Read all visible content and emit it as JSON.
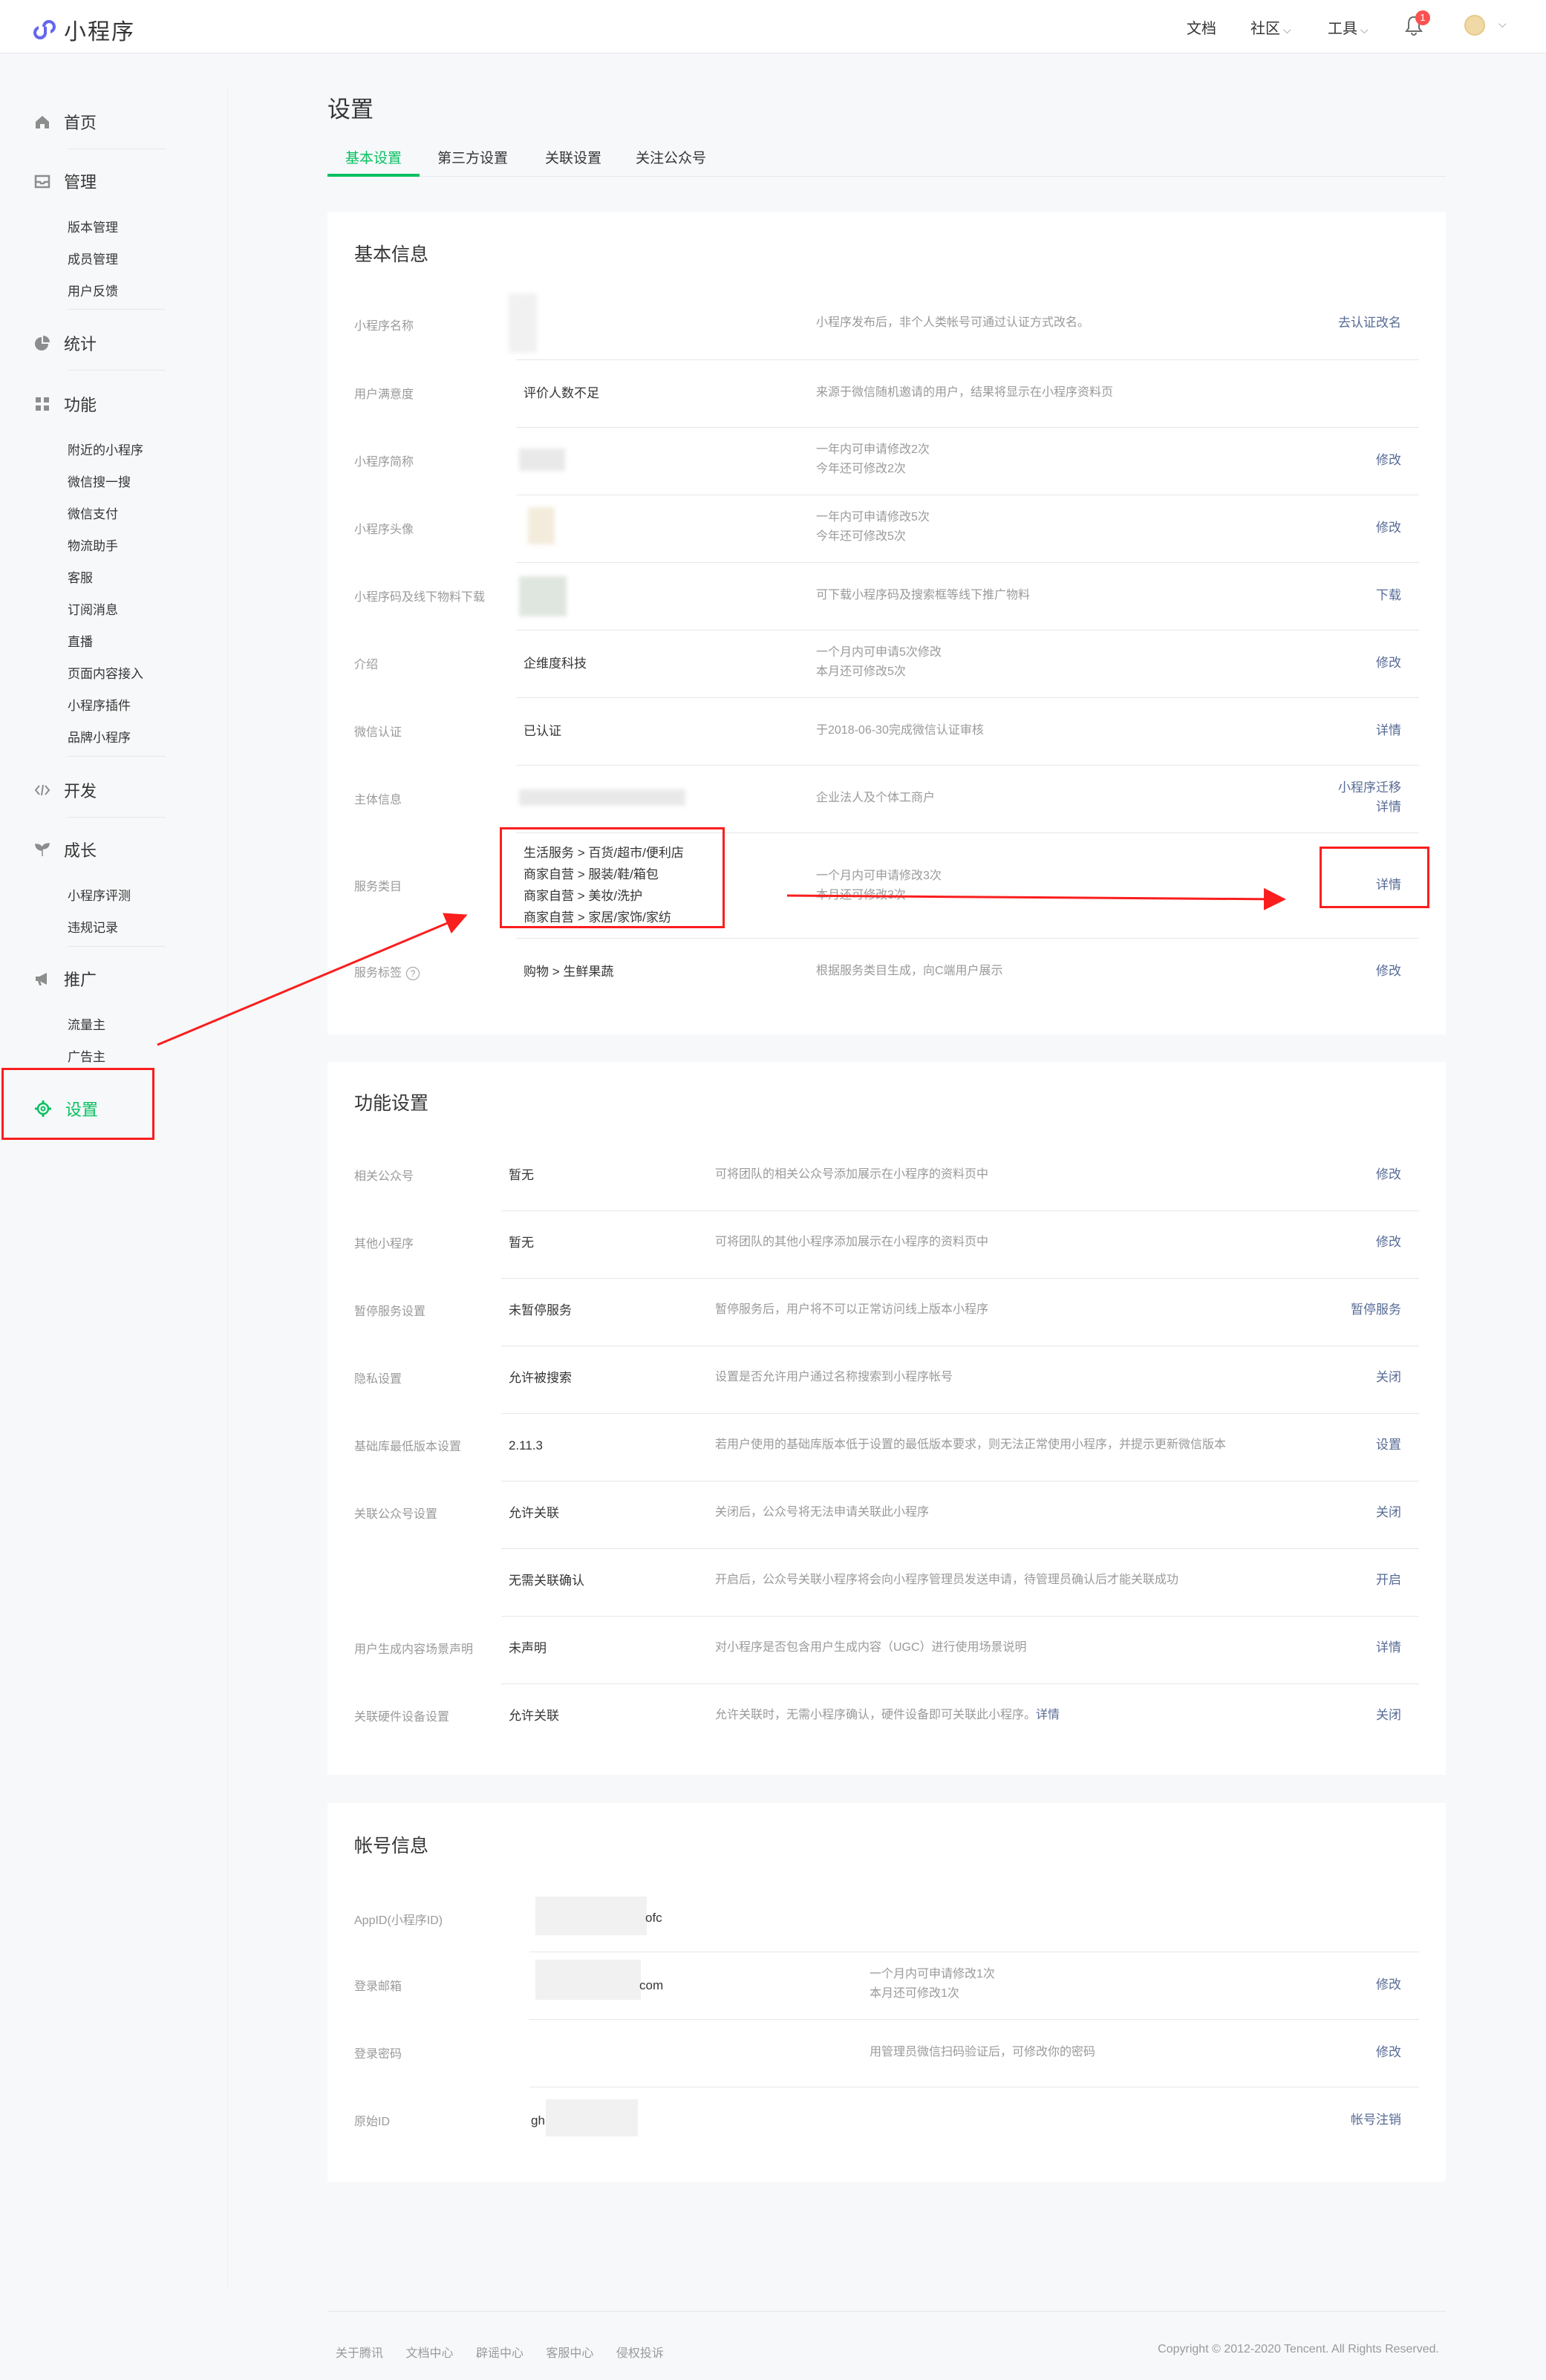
{
  "topbar": {
    "app_name": "小程序",
    "nav": {
      "docs": "文档",
      "community": "社区",
      "tools": "工具"
    },
    "notification_count": "1"
  },
  "sidebar": {
    "home": "首页",
    "manage": {
      "label": "管理",
      "items": [
        "版本管理",
        "成员管理",
        "用户反馈"
      ]
    },
    "stats": "统计",
    "features": {
      "label": "功能",
      "items": [
        "附近的小程序",
        "微信搜一搜",
        "微信支付",
        "物流助手",
        "客服",
        "订阅消息",
        "直播",
        "页面内容接入",
        "小程序插件",
        "品牌小程序"
      ]
    },
    "develop": "开发",
    "growth": {
      "label": "成长",
      "items": [
        "小程序评测",
        "违规记录"
      ]
    },
    "promote": {
      "label": "推广",
      "items": [
        "流量主",
        "广告主"
      ]
    },
    "settings": "设置"
  },
  "page": {
    "title": "设置",
    "tabs": [
      "基本设置",
      "第三方设置",
      "关联设置",
      "关注公众号"
    ]
  },
  "basic_info": {
    "title": "基本信息",
    "rows": [
      {
        "label": "小程序名称",
        "value": "",
        "desc": [
          "小程序发布后，非个人类帐号可通过认证方式改名。"
        ],
        "action": "去认证改名"
      },
      {
        "label": "用户满意度",
        "value": "评价人数不足",
        "desc": [
          "来源于微信随机邀请的用户，结果将显示在小程序资料页"
        ],
        "action": ""
      },
      {
        "label": "小程序简称",
        "value": "",
        "desc": [
          "一年内可申请修改2次",
          "今年还可修改2次"
        ],
        "action": "修改"
      },
      {
        "label": "小程序头像",
        "value": "",
        "desc": [
          "一年内可申请修改5次",
          "今年还可修改5次"
        ],
        "action": "修改"
      },
      {
        "label": "小程序码及线下物料下载",
        "value": "",
        "desc": [
          "可下载小程序码及搜索框等线下推广物料"
        ],
        "action": "下载"
      },
      {
        "label": "介绍",
        "value": "企维度科技",
        "desc": [
          "一个月内可申请5次修改",
          "本月还可修改5次"
        ],
        "action": "修改"
      },
      {
        "label": "微信认证",
        "value": "已认证",
        "desc": [
          "于2018-06-30完成微信认证审核"
        ],
        "action": "详情"
      },
      {
        "label": "主体信息",
        "value": "",
        "desc": [
          "企业法人及个体工商户"
        ],
        "action": "小程序迁移",
        "action2": "详情"
      },
      {
        "label": "服务类目",
        "value_lines": [
          "生活服务 > 百货/超市/便利店",
          "商家自营 > 服装/鞋/箱包",
          "商家自营 > 美妆/洗护",
          "商家自营 > 家居/家饰/家纺"
        ],
        "desc": [
          "一个月内可申请修改3次",
          "本月还可修改3次"
        ],
        "action": "详情"
      },
      {
        "label": "服务标签",
        "value": "购物 > 生鲜果蔬",
        "desc": [
          "根据服务类目生成，向C端用户展示"
        ],
        "action": "修改"
      }
    ]
  },
  "feature_settings": {
    "title": "功能设置",
    "rows": [
      {
        "label": "相关公众号",
        "value": "暂无",
        "desc": "可将团队的相关公众号添加展示在小程序的资料页中",
        "action": "修改"
      },
      {
        "label": "其他小程序",
        "value": "暂无",
        "desc": "可将团队的其他小程序添加展示在小程序的资料页中",
        "action": "修改"
      },
      {
        "label": "暂停服务设置",
        "value": "未暂停服务",
        "desc": "暂停服务后，用户将不可以正常访问线上版本小程序",
        "action": "暂停服务"
      },
      {
        "label": "隐私设置",
        "value": "允许被搜索",
        "desc": "设置是否允许用户通过名称搜索到小程序帐号",
        "action": "关闭"
      },
      {
        "label": "基础库最低版本设置",
        "value": "2.11.3",
        "desc": "若用户使用的基础库版本低于设置的最低版本要求，则无法正常使用小程序，并提示更新微信版本",
        "action": "设置"
      },
      {
        "label": "关联公众号设置",
        "value": "允许关联",
        "desc": "关闭后，公众号将无法申请关联此小程序",
        "action": "关闭"
      },
      {
        "label": "",
        "value": "无需关联确认",
        "desc": "开启后，公众号关联小程序将会向小程序管理员发送申请，待管理员确认后才能关联成功",
        "action": "开启"
      },
      {
        "label": "用户生成内容场景声明",
        "value": "未声明",
        "desc": "对小程序是否包含用户生成内容（UGC）进行使用场景说明",
        "action": "详情"
      },
      {
        "label": "关联硬件设备设置",
        "value": "允许关联",
        "desc": "允许关联时，无需小程序确认，硬件设备即可关联此小程序。",
        "desc_link": "详情",
        "action": "关闭"
      }
    ]
  },
  "account_info": {
    "title": "帐号信息",
    "rows": [
      {
        "label": "AppID(小程序ID)",
        "value": "ofc",
        "desc": [],
        "action": ""
      },
      {
        "label": "登录邮箱",
        "value": "com",
        "desc": [
          "一个月内可申请修改1次",
          "本月还可修改1次"
        ],
        "action": "修改"
      },
      {
        "label": "登录密码",
        "value": "",
        "desc": [
          "用管理员微信扫码验证后，可修改你的密码"
        ],
        "action": "修改"
      },
      {
        "label": "原始ID",
        "value": "gh",
        "desc": [],
        "action": "帐号注销"
      }
    ]
  },
  "footer": {
    "links": [
      "关于腾讯",
      "文档中心",
      "辟谣中心",
      "客服中心",
      "侵权投诉"
    ],
    "copyright": "Copyright © 2012-2020 Tencent. All Rights Reserved."
  },
  "colors": {
    "accent": "#07c160",
    "link": "#576b95",
    "annotation": "#fa1e1e",
    "badge": "#fa5151"
  }
}
